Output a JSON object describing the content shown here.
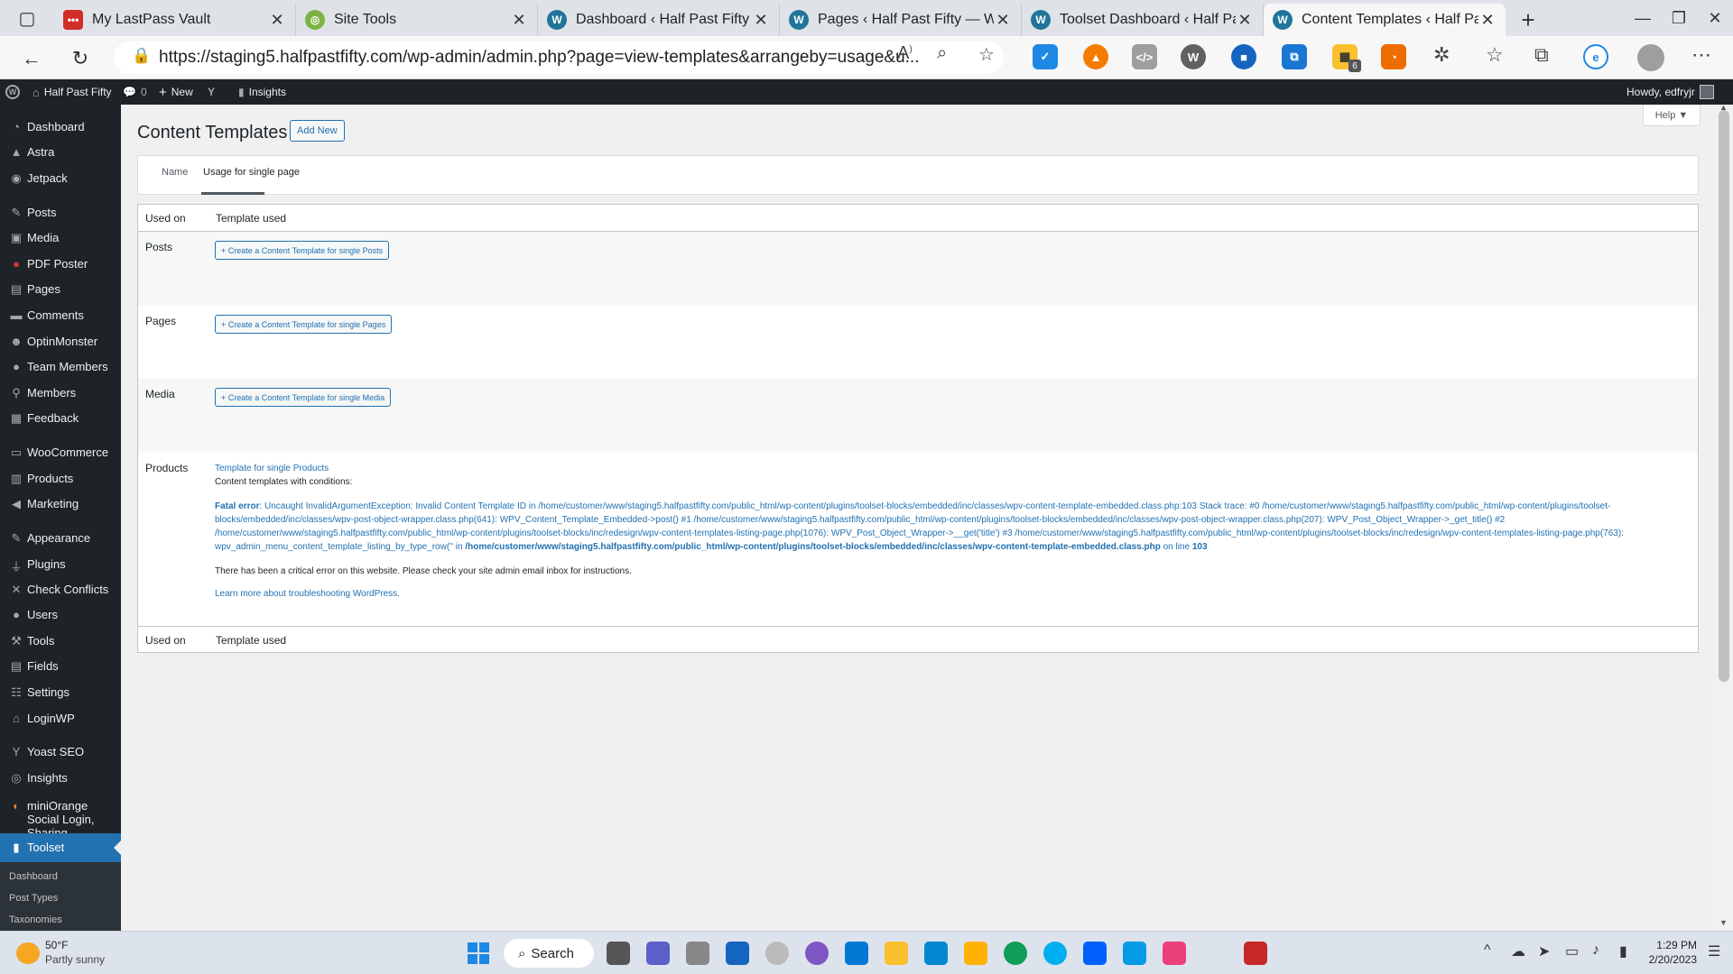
{
  "browser": {
    "tabs": [
      {
        "title": "My LastPass Vault",
        "icon": "lastpass-icon",
        "color": "#d32d27"
      },
      {
        "title": "Site Tools",
        "icon": "siteground-icon",
        "color": "#7cb342"
      },
      {
        "title": "Dashboard ‹ Half Past Fifty —",
        "icon": "wordpress-icon",
        "color": "#21759b"
      },
      {
        "title": "Pages ‹ Half Past Fifty — Wo",
        "icon": "wordpress-icon",
        "color": "#21759b"
      },
      {
        "title": "Toolset Dashboard ‹ Half Pa",
        "icon": "wordpress-icon",
        "color": "#21759b"
      },
      {
        "title": "Content Templates ‹ Half Pa",
        "icon": "wordpress-icon",
        "color": "#21759b"
      }
    ],
    "url": "https://staging5.halfpastfifty.com/wp-admin/admin.php?page=view-templates&arrangeby=usage&u...",
    "extension_badge": "6"
  },
  "adminbar": {
    "site_name": "Half Past Fifty",
    "comments_count": "0",
    "new_label": "New",
    "insights_label": "Insights",
    "howdy": "Howdy, edfryjr"
  },
  "sidebar": {
    "items": [
      {
        "label": "Dashboard"
      },
      {
        "label": "Astra"
      },
      {
        "label": "Jetpack"
      },
      {
        "label": "Posts"
      },
      {
        "label": "Media"
      },
      {
        "label": "PDF Poster"
      },
      {
        "label": "Pages"
      },
      {
        "label": "Comments"
      },
      {
        "label": "OptinMonster"
      },
      {
        "label": "Team Members"
      },
      {
        "label": "Members"
      },
      {
        "label": "Feedback"
      },
      {
        "label": "WooCommerce"
      },
      {
        "label": "Products"
      },
      {
        "label": "Marketing"
      },
      {
        "label": "Appearance"
      },
      {
        "label": "Plugins"
      },
      {
        "label": "Check Conflicts"
      },
      {
        "label": "Users"
      },
      {
        "label": "Tools"
      },
      {
        "label": "Fields"
      },
      {
        "label": "Settings"
      },
      {
        "label": "LoginWP"
      },
      {
        "label": "Yoast SEO"
      },
      {
        "label": "Insights"
      },
      {
        "label": "miniOrange Social Login, Sharing"
      },
      {
        "label": "Toolset"
      }
    ],
    "submenu": [
      "Dashboard",
      "Post Types",
      "Taxonomies"
    ]
  },
  "page": {
    "title": "Content Templates",
    "add_new": "Add New",
    "help": "Help ▼",
    "sort_tabs": [
      "Name",
      "Usage for single page"
    ],
    "col_used_on": "Used on",
    "col_template_used": "Template used",
    "rows": [
      {
        "label": "Posts",
        "button": "+ Create a Content Template for single Posts"
      },
      {
        "label": "Pages",
        "button": "+ Create a Content Template for single Pages"
      },
      {
        "label": "Media",
        "button": "+ Create a Content Template for single Media"
      }
    ],
    "products": {
      "label": "Products",
      "template_link": "Template for single Products",
      "conditions": "Content templates with conditions:",
      "fatal_label": "Fatal error",
      "fatal_text": ": Uncaught InvalidArgumentException: Invalid Content Template ID in /home/customer/www/staging5.halfpastfifty.com/public_html/wp-content/plugins/toolset-blocks/embedded/inc/classes/wpv-content-template-embedded.class.php:103 Stack trace: #0 /home/customer/www/staging5.halfpastfifty.com/public_html/wp-content/plugins/toolset-blocks/embedded/inc/classes/wpv-post-object-wrapper.class.php(641): WPV_Content_Template_Embedded->post() #1 /home/customer/www/staging5.halfpastfifty.com/public_html/wp-content/plugins/toolset-blocks/embedded/inc/classes/wpv-post-object-wrapper.class.php(207): WPV_Post_Object_Wrapper->_get_title() #2 /home/customer/www/staging5.halfpastfifty.com/public_html/wp-content/plugins/toolset-blocks/inc/redesign/wpv-content-templates-listing-page.php(1076): WPV_Post_Object_Wrapper->__get('title') #3 /home/customer/www/staging5.halfpastfifty.com/public_html/wp-content/plugins/toolset-blocks/inc/redesign/wpv-content-templates-listing-page.php(763): wpv_admin_menu_content_template_listing_by_type_row('' in ",
      "fatal_file": "/home/customer/www/staging5.halfpastfifty.com/public_html/wp-content/plugins/toolset-blocks/embedded/inc/classes/wpv-content-template-embedded.class.php",
      "fatal_line_prefix": " on line ",
      "fatal_line": "103",
      "critical": "There has been a critical error on this website. Please check your site admin email inbox for instructions.",
      "learn_more": "Learn more about troubleshooting WordPress."
    }
  },
  "taskbar": {
    "weather_temp": "50°F",
    "weather_desc": "Partly sunny",
    "search": "Search",
    "time": "1:29 PM",
    "date": "2/20/2023"
  }
}
